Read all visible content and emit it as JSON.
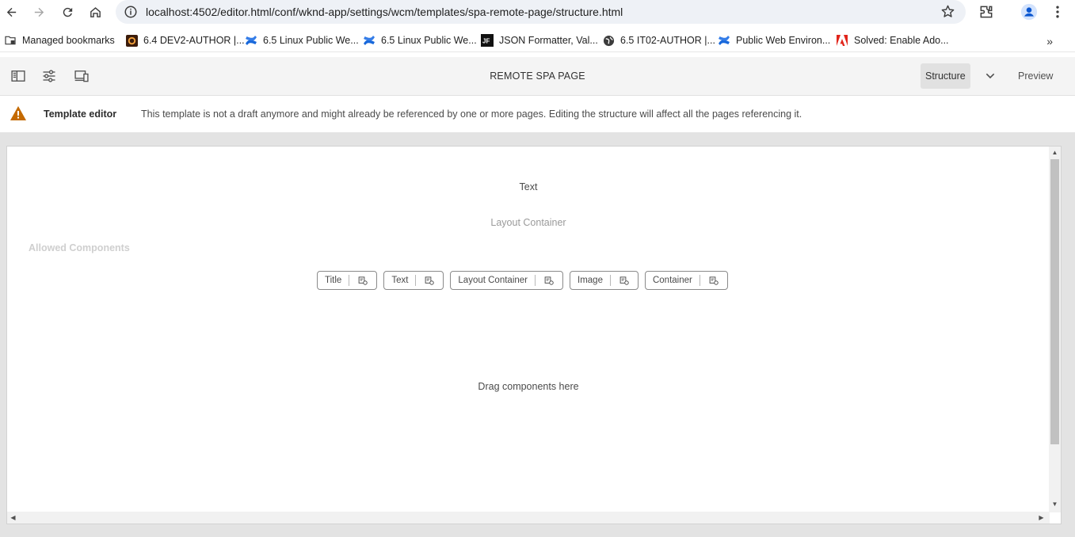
{
  "browser": {
    "url": "localhost:4502/editor.html/conf/wknd-app/settings/wcm/templates/spa-remote-page/structure.html",
    "bookmarks": [
      {
        "label": "Managed bookmarks",
        "icon": "folder-managed-icon"
      },
      {
        "label": "6.4 DEV2-AUTHOR |...",
        "icon": "aem-icon"
      },
      {
        "label": "6.5 Linux Public We...",
        "icon": "confluence-icon"
      },
      {
        "label": "6.5 Linux Public We...",
        "icon": "confluence-icon"
      },
      {
        "label": "JSON Formatter, Val...",
        "icon": "jf-icon"
      },
      {
        "label": "6.5 IT02-AUTHOR |...",
        "icon": "globe-icon"
      },
      {
        "label": "Public Web Environ...",
        "icon": "confluence-icon"
      },
      {
        "label": "Solved: Enable Ado...",
        "icon": "adobe-icon"
      }
    ],
    "more_label": "»"
  },
  "editor": {
    "page_title": "REMOTE SPA PAGE",
    "modes": {
      "structure": "Structure",
      "preview": "Preview"
    }
  },
  "notice": {
    "title": "Template editor",
    "message": "This template is not a draft anymore and might already be referenced by one or more pages. Editing the structure will affect all the pages referencing it."
  },
  "canvas": {
    "text_component": "Text",
    "layout_container": "Layout Container",
    "allowed_label": "Allowed Components",
    "allowed_components": [
      "Title",
      "Text",
      "Layout Container",
      "Image",
      "Container"
    ],
    "drop_zone": "Drag components here"
  },
  "colors": {
    "warning": "#c46a00",
    "toolbar_bg": "#f4f4f4",
    "omnibox_bg": "#eef1f6",
    "confluence_blue": "#1868db",
    "adobe_red": "#e1251b"
  }
}
